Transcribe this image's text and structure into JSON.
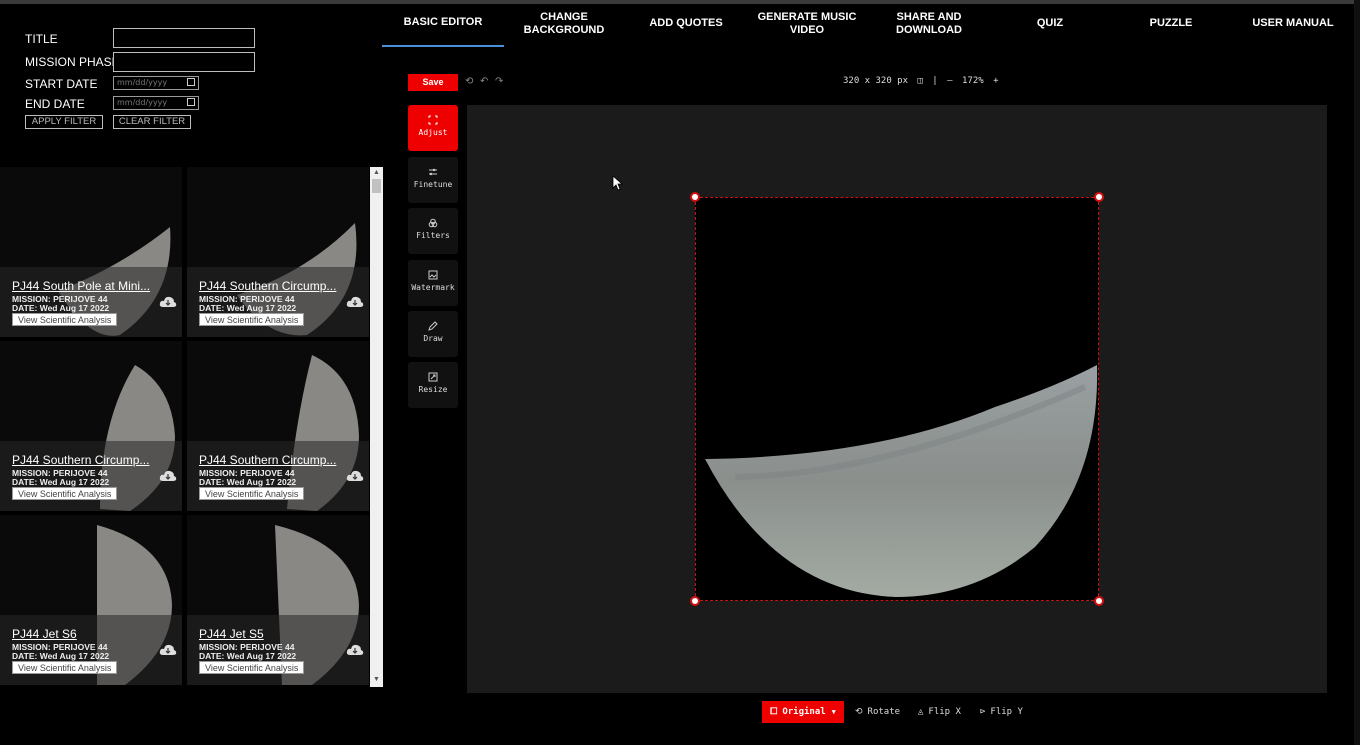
{
  "filter": {
    "title_label": "TITLE",
    "phase_label": "MISSION PHASE",
    "start_label": "START DATE",
    "end_label": "END DATE",
    "date_placeholder": "mm/dd/yyyy",
    "apply_label": "APPLY FILTER",
    "clear_label": "CLEAR FILTER"
  },
  "gallery": {
    "view_label": "View Scientific Analysis",
    "cards": [
      {
        "title": "PJ44 South Pole at Mini...",
        "mission": "MISSION: PERIJOVE 44",
        "date": "DATE: Wed Aug 17 2022"
      },
      {
        "title": "PJ44 Southern Circump...",
        "mission": "MISSION: PERIJOVE 44",
        "date": "DATE: Wed Aug 17 2022"
      },
      {
        "title": "PJ44 Southern Circump...",
        "mission": "MISSION: PERIJOVE 44",
        "date": "DATE: Wed Aug 17 2022"
      },
      {
        "title": "PJ44 Southern Circump...",
        "mission": "MISSION: PERIJOVE 44",
        "date": "DATE: Wed Aug 17 2022"
      },
      {
        "title": "PJ44 Jet S6",
        "mission": "MISSION: PERIJOVE 44",
        "date": "DATE: Wed Aug 17 2022"
      },
      {
        "title": "PJ44 Jet S5",
        "mission": "MISSION: PERIJOVE 44",
        "date": "DATE: Wed Aug 17 2022"
      }
    ]
  },
  "tabs": [
    "BASIC EDITOR",
    "CHANGE\nBACKGROUND",
    "ADD QUOTES",
    "GENERATE MUSIC\nVIDEO",
    "SHARE AND\nDOWNLOAD",
    "QUIZ",
    "PUZZLE",
    "USER MANUAL"
  ],
  "toolbar": {
    "save_label": "Save",
    "dimensions": "320 x 320 px",
    "zoom": "172%"
  },
  "tools": [
    "Adjust",
    "Finetune",
    "Filters",
    "Watermark",
    "Draw",
    "Resize"
  ],
  "bottom": {
    "original_label": "Original",
    "rotate_label": "Rotate",
    "flipx_label": "Flip X",
    "flipy_label": "Flip Y"
  },
  "colors": {
    "accent": "#e00000",
    "tab_underline": "#4a8fd8"
  }
}
